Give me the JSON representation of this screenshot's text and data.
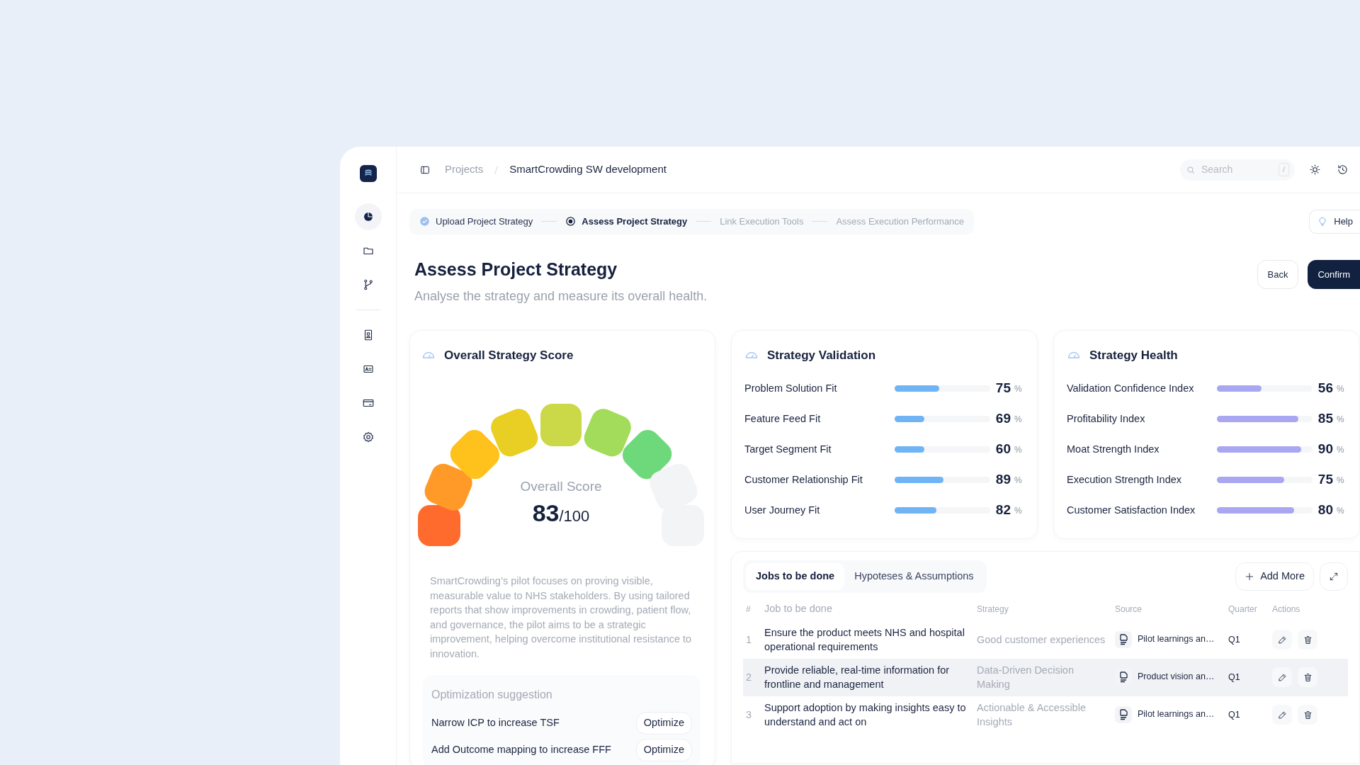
{
  "sidebar": {
    "groups": [
      [
        {
          "kind": "chart",
          "selected": true
        },
        {
          "kind": "folder",
          "selected": false
        },
        {
          "kind": "branch",
          "selected": false
        }
      ],
      [
        {
          "kind": "contact",
          "selected": false
        },
        {
          "kind": "id-card",
          "selected": false
        },
        {
          "kind": "card",
          "selected": false
        },
        {
          "kind": "settings",
          "selected": false
        }
      ]
    ]
  },
  "breadcrumb": [
    "Projects",
    "SmartCrowding SW development"
  ],
  "search": {
    "placeholder": "Search",
    "shortcut": "/"
  },
  "stepper": [
    {
      "label": "Upload Project Strategy",
      "completed": true,
      "selected": false
    },
    {
      "label": "Assess Project Strategy",
      "completed": false,
      "selected": true
    },
    {
      "label": "Link Execution Tools",
      "completed": false,
      "selected": false
    },
    {
      "label": "Assess Execution Performance",
      "completed": false,
      "selected": false
    }
  ],
  "help": "Help",
  "page": {
    "title": "Assess Project Strategy",
    "subtitle": "Analyse the strategy and measure its overall health.",
    "buttons": [
      {
        "label": "Back",
        "kind": "secondary"
      },
      {
        "label": "Confirm",
        "kind": "primary"
      }
    ]
  },
  "score_card": {
    "title": "Overall Strategy Score",
    "gauge": {
      "level": 0.78
    },
    "label": "Overall Score",
    "score": "83",
    "total": "/100",
    "summary": "SmartCrowding’s pilot focuses on proving visible, measurable value to NHS stakeholders. By using tailored reports that show improvements in crowding, patient flow, and governance, the pilot aims to be a strategic improvement, helping overcome institutional resistance to innovation.",
    "suggestions": {
      "title": "Optimization suggestion",
      "items": [
        {
          "text": "Narrow ICP to increase TSF",
          "action": "Optimize"
        },
        {
          "text": "Add Outcome mapping to increase FFF",
          "action": "Optimize"
        }
      ]
    }
  },
  "validation": {
    "title": "Strategy Validation",
    "rows": [
      {
        "name": "Problem Solution Fit",
        "level": 0.47,
        "value": "75",
        "unit": "%"
      },
      {
        "name": "Feature Feed Fit",
        "level": 0.31,
        "value": "69",
        "unit": "%"
      },
      {
        "name": "Target Segment Fit",
        "level": 0.31,
        "value": "60",
        "unit": "%"
      },
      {
        "name": "Customer Relationship Fit",
        "level": 0.51,
        "value": "89",
        "unit": "%"
      },
      {
        "name": "User Journey Fit",
        "level": 0.44,
        "value": "82",
        "unit": "%"
      }
    ]
  },
  "health": {
    "title": "Strategy Health",
    "rows": [
      {
        "name": "Validation Confidence Index",
        "level": 0.47,
        "value": "56",
        "unit": "%"
      },
      {
        "name": "Profitability Index",
        "level": 0.85,
        "value": "85",
        "unit": "%"
      },
      {
        "name": "Moat Strength Index",
        "level": 0.88,
        "value": "90",
        "unit": "%"
      },
      {
        "name": "Execution Strength Index",
        "level": 0.7,
        "value": "75",
        "unit": "%"
      },
      {
        "name": "Customer Satisfaction Index",
        "level": 0.81,
        "value": "80",
        "unit": "%"
      }
    ]
  },
  "jobs": {
    "tabs": [
      {
        "label": "Jobs to be done",
        "selected": true
      },
      {
        "label": "Hypoteses & Assumptions",
        "selected": false
      }
    ],
    "add_button": "Add More",
    "columns": [
      "#",
      "Job to be done",
      "Strategy",
      "Source",
      "Quarter",
      "Actions"
    ],
    "rows": [
      {
        "index": "1",
        "job": "Ensure the product meets NHS and hospital operational requirements",
        "strategy": "Good customer experiences",
        "source": "Pilot learnings an…",
        "quarter": "Q1",
        "selected": false
      },
      {
        "index": "2",
        "job": "Provide reliable, real-time information for frontline and management",
        "strategy": "Data-Driven Decision Making",
        "source": "Product vision an…",
        "quarter": "Q1",
        "selected": true
      },
      {
        "index": "3",
        "job": "Support adoption by making insights easy to understand and act on",
        "strategy": "Actionable & Accessible Insights",
        "source": "Pilot learnings an…",
        "quarter": "Q1",
        "selected": false
      }
    ]
  }
}
